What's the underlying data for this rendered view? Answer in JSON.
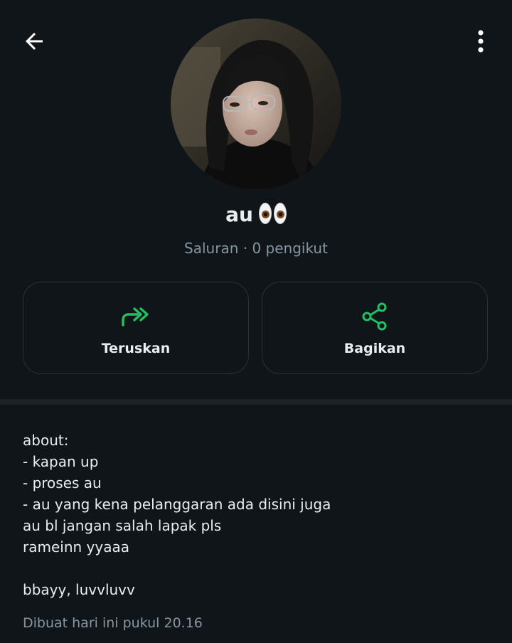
{
  "header": {
    "back_icon": "arrow-left-icon",
    "more_icon": "more-vertical-icon"
  },
  "channel": {
    "name": "au",
    "name_emoji": "eyes-emoji",
    "meta": "Saluran · 0 pengikut"
  },
  "actions": [
    {
      "label": "Teruskan",
      "icon": "forward-icon",
      "color": "#21c063"
    },
    {
      "label": "Bagikan",
      "icon": "share-icon",
      "color": "#21c063"
    }
  ],
  "description": "about:\n- kapan up\n- proses au\n- au yang kena pelanggaran ada disini juga\nau bl jangan salah lapak pls\nrameinn yyaaa\n\nbbayy, luvvluvv",
  "created_at": "Dibuat hari ini pukul 20.16",
  "colors": {
    "background": "#0f1519",
    "accent": "#21c063",
    "secondary_text": "#8696a0"
  }
}
